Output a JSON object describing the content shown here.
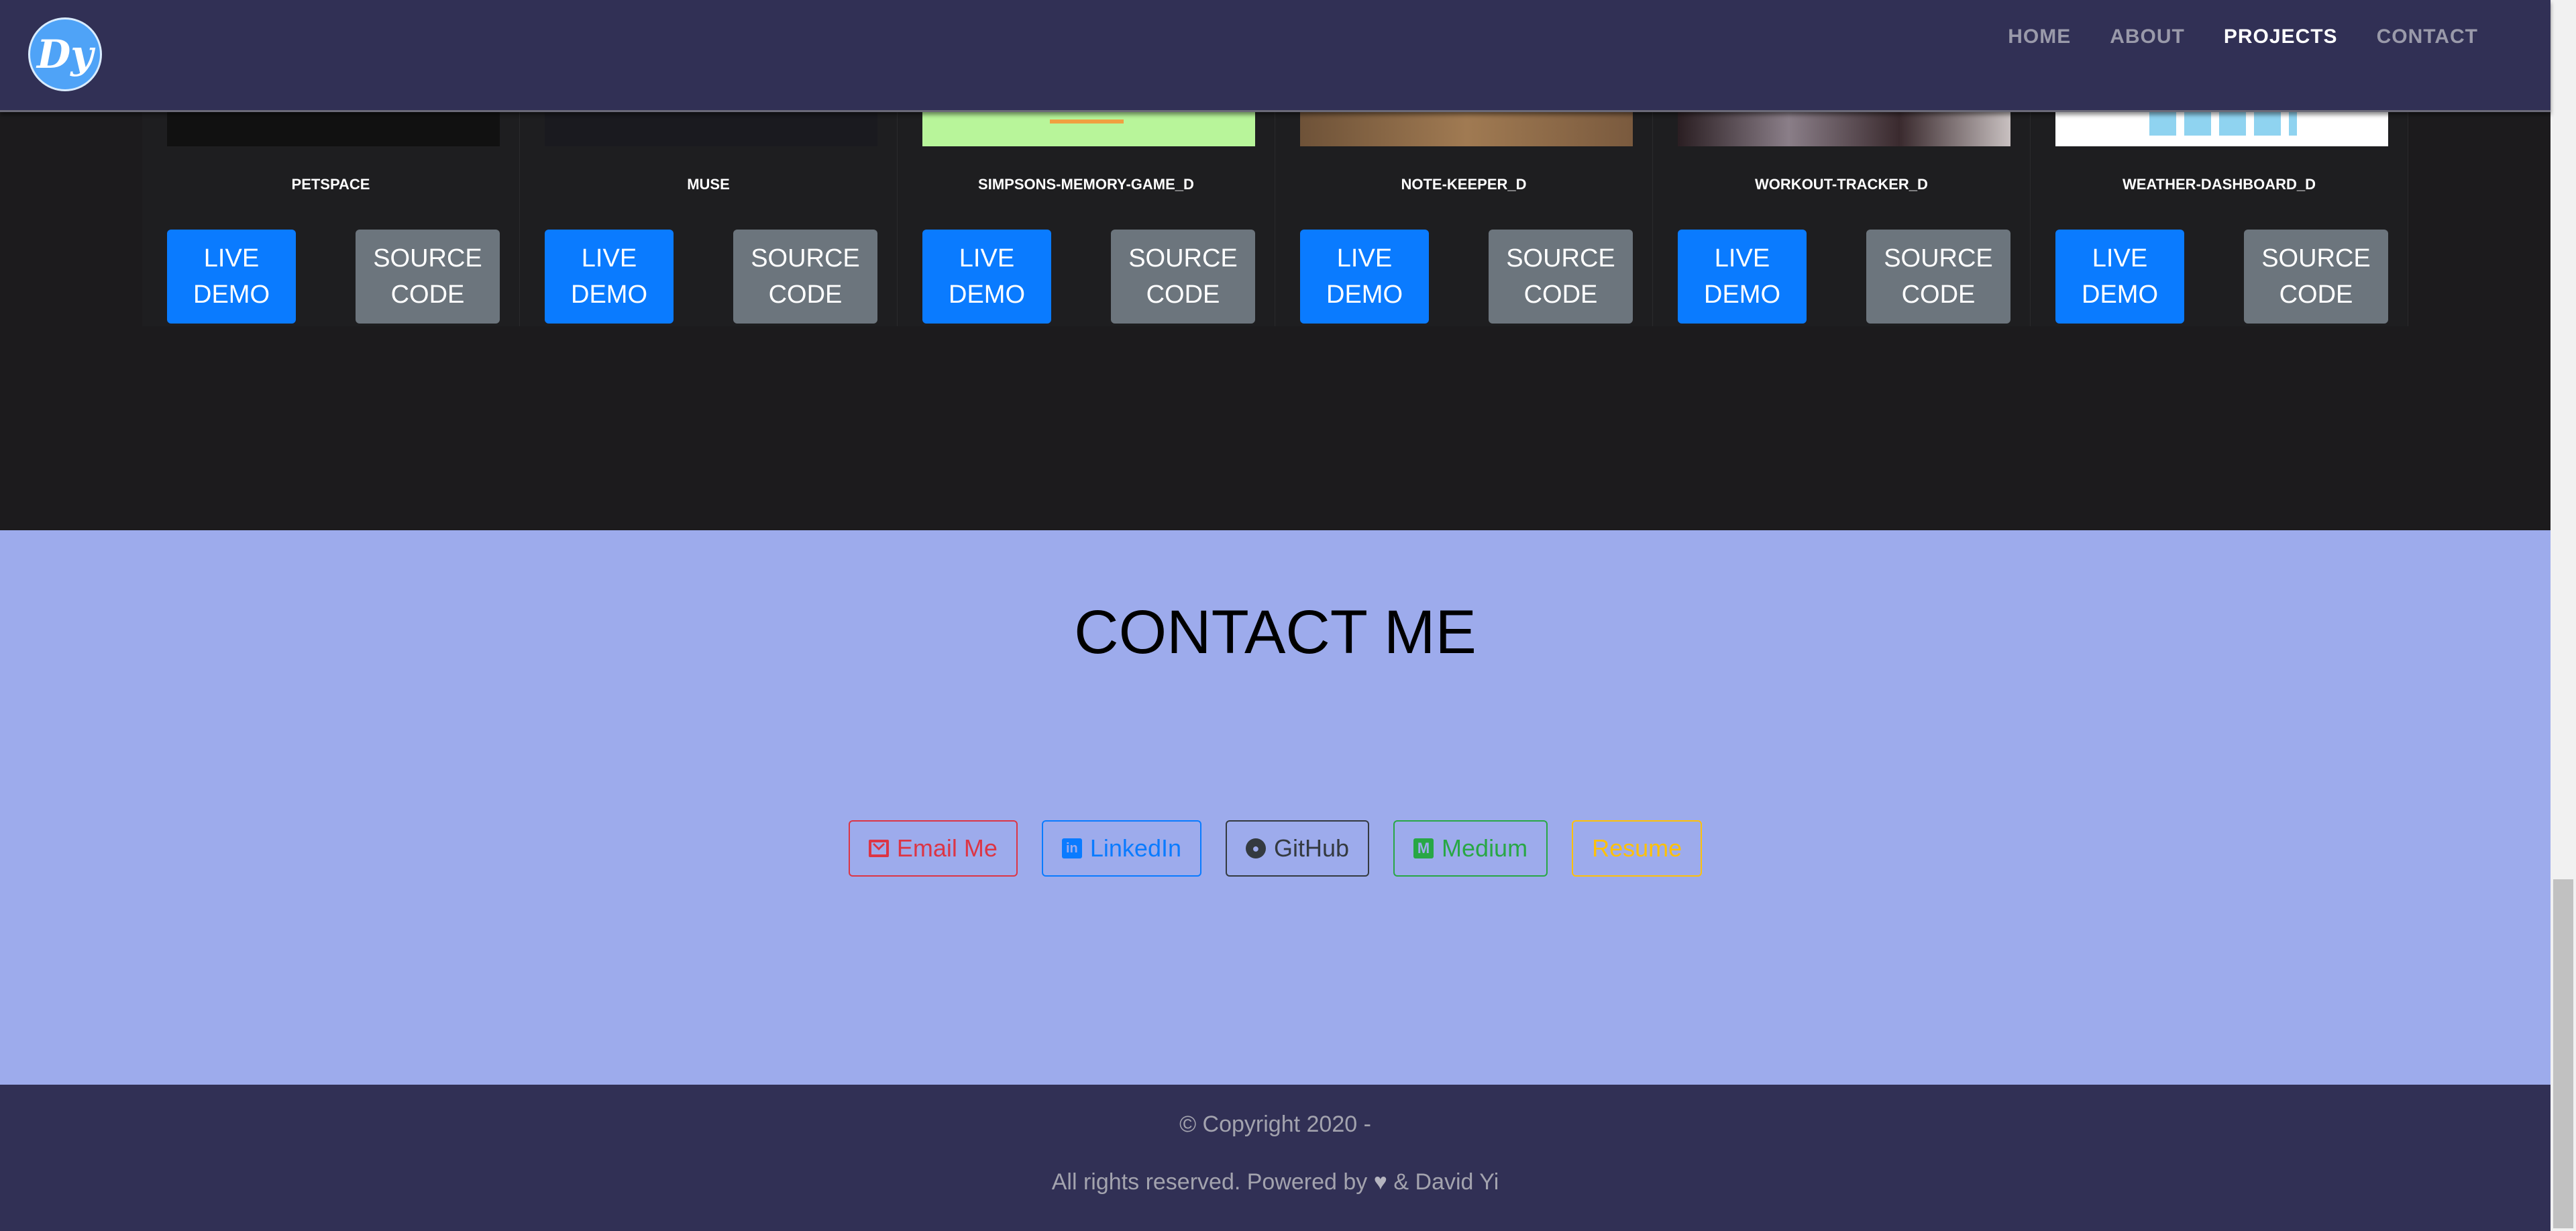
{
  "nav": {
    "logo_text": "Dy",
    "links": [
      {
        "label": "HOME",
        "active": false
      },
      {
        "label": "ABOUT",
        "active": false
      },
      {
        "label": "PROJECTS",
        "active": true
      },
      {
        "label": "CONTACT",
        "active": false
      }
    ]
  },
  "projects": {
    "cards": [
      {
        "title": "PETSPACE",
        "demo_label": [
          "LIVE",
          "DEMO"
        ],
        "source_label": [
          "SOURCE",
          "CODE"
        ],
        "image_color": "#121212"
      },
      {
        "title": "MUSE",
        "demo_label": [
          "LIVE",
          "DEMO"
        ],
        "source_label": [
          "SOURCE",
          "CODE"
        ],
        "image_color": "#1a1a1f"
      },
      {
        "title": "SIMPSONS-MEMORY-GAME_D",
        "demo_label": [
          "LIVE",
          "DEMO"
        ],
        "source_label": [
          "SOURCE",
          "CODE"
        ],
        "image_color": "#b8f59a"
      },
      {
        "title": "NOTE-KEEPER_D",
        "demo_label": [
          "LIVE",
          "DEMO"
        ],
        "source_label": [
          "SOURCE",
          "CODE"
        ],
        "image_color": "#8a6a4a"
      },
      {
        "title": "WORKOUT-TRACKER_D",
        "demo_label": [
          "LIVE",
          "DEMO"
        ],
        "source_label": [
          "SOURCE",
          "CODE"
        ],
        "image_color": "#3a2a2e"
      },
      {
        "title": "WEATHER-DASHBOARD_D",
        "demo_label": [
          "LIVE",
          "DEMO"
        ],
        "source_label": [
          "SOURCE",
          "CODE"
        ],
        "image_color": "#ffffff"
      }
    ]
  },
  "contact": {
    "title": "CONTACT ME",
    "links": [
      {
        "label": "Email Me",
        "icon": "envelope-icon",
        "color": "#dc3545"
      },
      {
        "label": "LinkedIn",
        "icon": "linkedin-icon",
        "color": "#0a7bff"
      },
      {
        "label": "GitHub",
        "icon": "github-icon",
        "color": "#343a40"
      },
      {
        "label": "Medium",
        "icon": "medium-icon",
        "color": "#28a745"
      },
      {
        "label": "Resume",
        "icon": "",
        "color": "#ffc107"
      }
    ]
  },
  "footer": {
    "copyright": "© Copyright 2020 -",
    "rights_prefix": "All rights reserved. Powered by",
    "rights_suffix": "& David Yi"
  },
  "colors": {
    "navbar_bg": "#313055",
    "projects_bg": "#1c1b1d",
    "contact_bg": "#9dabec",
    "primary": "#0a7bff",
    "secondary": "#6c757d"
  }
}
